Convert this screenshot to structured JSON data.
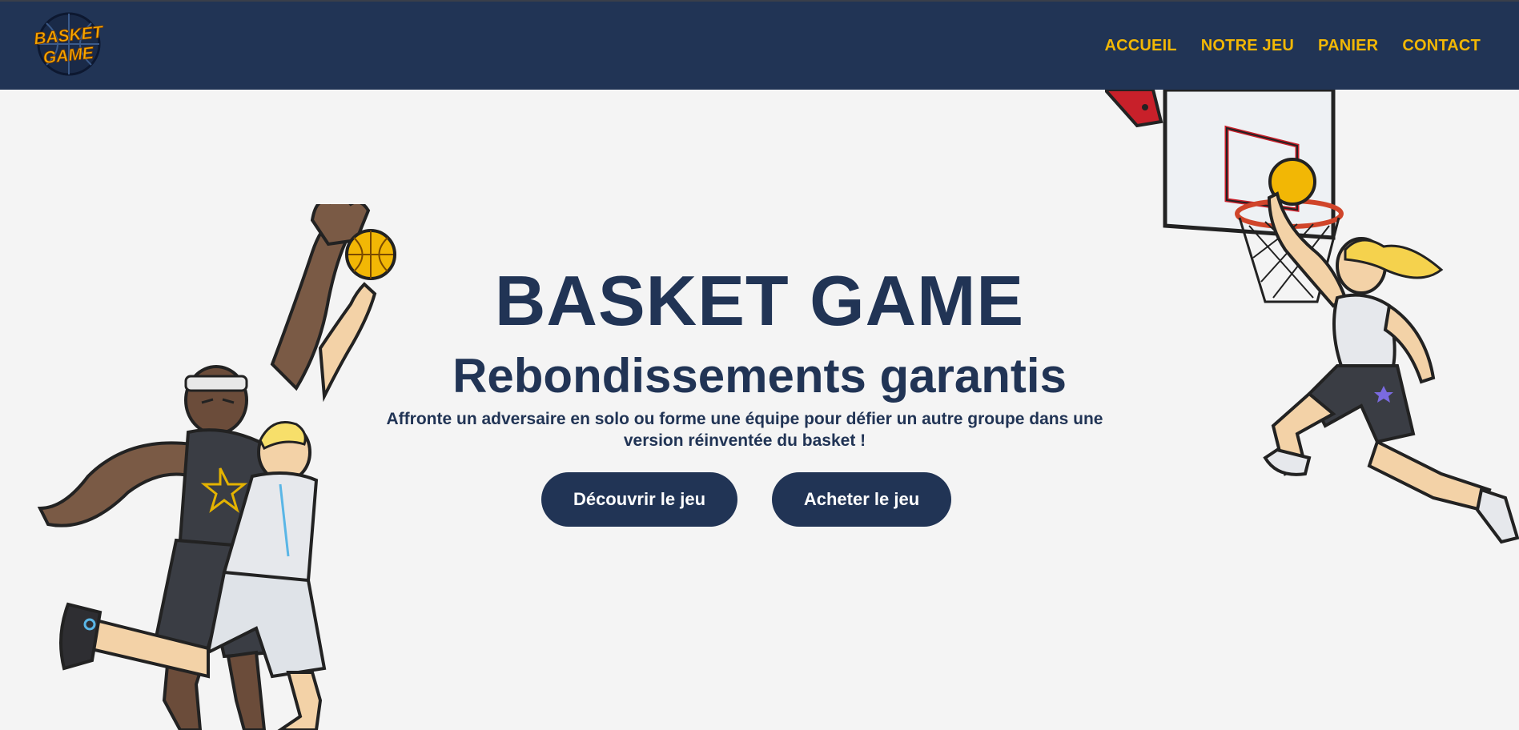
{
  "brand": {
    "logo_line1": "BASKET",
    "logo_line2": "GAME",
    "colors": {
      "navy": "#213455",
      "accent": "#f2b705",
      "background": "#f4f4f4"
    }
  },
  "nav": {
    "items": [
      {
        "label": "ACCUEIL"
      },
      {
        "label": "NOTRE JEU"
      },
      {
        "label": "PANIER"
      },
      {
        "label": "CONTACT"
      }
    ]
  },
  "hero": {
    "title": "BASKET GAME",
    "subtitle": "Rebondissements garantis",
    "description": "Affronte un adversaire en solo ou forme une équipe pour défier un autre groupe dans une version réinventée du basket !",
    "buttons": {
      "discover": "Découvrir le jeu",
      "buy": "Acheter le jeu"
    }
  },
  "illustrations": {
    "left": "players-contest-illustration",
    "right": "player-dunk-illustration"
  }
}
